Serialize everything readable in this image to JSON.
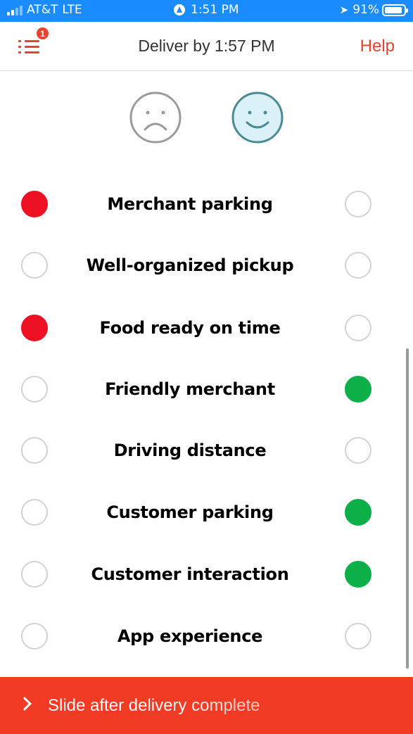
{
  "status_bar": {
    "carrier": "AT&T",
    "network": "LTE",
    "time": "1:51 PM",
    "battery": "91%",
    "battery_level": 0.91,
    "signal_bars_active": 2,
    "signal_bars_total": 4
  },
  "header": {
    "title": "Deliver by 1:57 PM",
    "menu_badge": "1",
    "help_label": "Help"
  },
  "faces": {
    "sad_icon": "sad-face-icon",
    "happy_icon": "happy-face-icon",
    "selected": "happy"
  },
  "ratings": [
    {
      "label": "Merchant parking",
      "sad_selected": true,
      "happy_selected": false
    },
    {
      "label": "Well-organized pickup",
      "sad_selected": false,
      "happy_selected": false
    },
    {
      "label": "Food ready on time",
      "sad_selected": true,
      "happy_selected": false
    },
    {
      "label": "Friendly merchant",
      "sad_selected": false,
      "happy_selected": true
    },
    {
      "label": "Driving distance",
      "sad_selected": false,
      "happy_selected": false
    },
    {
      "label": "Customer parking",
      "sad_selected": false,
      "happy_selected": true
    },
    {
      "label": "Customer interaction",
      "sad_selected": false,
      "happy_selected": true
    },
    {
      "label": "App experience",
      "sad_selected": false,
      "happy_selected": false
    }
  ],
  "slide_bar": {
    "label": "Slide after delivery complete",
    "icon": "chevron-right-icon"
  },
  "colors": {
    "status_bar": "#1a8cff",
    "accent": "#e8432e",
    "slide_bar": "#f23b25",
    "sad_selected": "#ee1023",
    "happy_selected": "#0db048",
    "happy_face_fill": "#d9f1f7",
    "happy_face_stroke": "#4a8a92"
  }
}
